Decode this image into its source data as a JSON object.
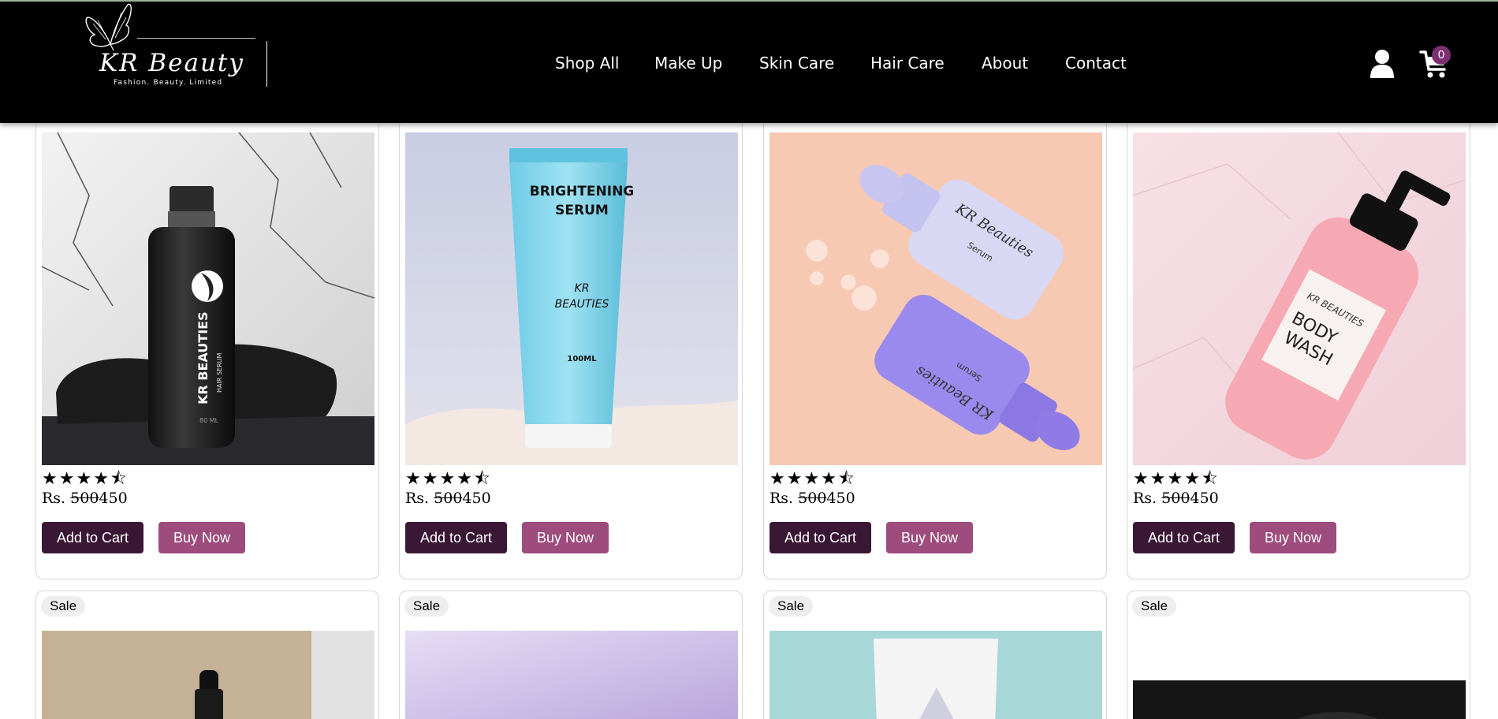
{
  "brand": {
    "name": "KR Beauty",
    "tagline": "Fashion. Beauty. Limited"
  },
  "nav": {
    "items": [
      {
        "label": "Shop All"
      },
      {
        "label": "Make Up"
      },
      {
        "label": "Skin Care"
      },
      {
        "label": "Hair Care"
      },
      {
        "label": "About"
      },
      {
        "label": "Contact"
      }
    ]
  },
  "cart": {
    "count": "0"
  },
  "colors": {
    "header_bg": "#000000",
    "add_to_cart": "#3a1735",
    "buy_now": "#9e4c7d",
    "badge": "#7e2f73"
  },
  "products": [
    {
      "image": "hair-serum-bottle",
      "image_text": [
        "KR BEAUTIES",
        "HAIR SERUM",
        "80 ML"
      ],
      "rating": 4.5,
      "currency": "Rs.",
      "old_price": "500",
      "price": "450",
      "add_label": "Add to Cart",
      "buy_label": "Buy Now"
    },
    {
      "image": "brightening-serum-tube",
      "image_text": [
        "BRIGHTENING",
        "SERUM",
        "KR",
        "BEAUTIES",
        "100ML"
      ],
      "rating": 4.5,
      "currency": "Rs.",
      "old_price": "500",
      "price": "450",
      "add_label": "Add to Cart",
      "buy_label": "Buy Now"
    },
    {
      "image": "serum-dropper-bottles",
      "image_text": [
        "KR Beauties",
        "Serum",
        "KR Beauties",
        "Serum"
      ],
      "rating": 4.5,
      "currency": "Rs.",
      "old_price": "500",
      "price": "450",
      "add_label": "Add to Cart",
      "buy_label": "Buy Now"
    },
    {
      "image": "body-wash-pump-bottle",
      "image_text": [
        "KR BEAUTIES",
        "BODY",
        "WASH"
      ],
      "rating": 4.5,
      "currency": "Rs.",
      "old_price": "500",
      "price": "450",
      "add_label": "Add to Cart",
      "buy_label": "Buy Now"
    }
  ],
  "next_row": [
    {
      "badge": "Sale",
      "image": "dropper-bottle"
    },
    {
      "badge": "Sale",
      "image": "lavender-product"
    },
    {
      "badge": "Sale",
      "image": "white-tube"
    },
    {
      "badge": "Sale",
      "image": "dark-product"
    }
  ]
}
